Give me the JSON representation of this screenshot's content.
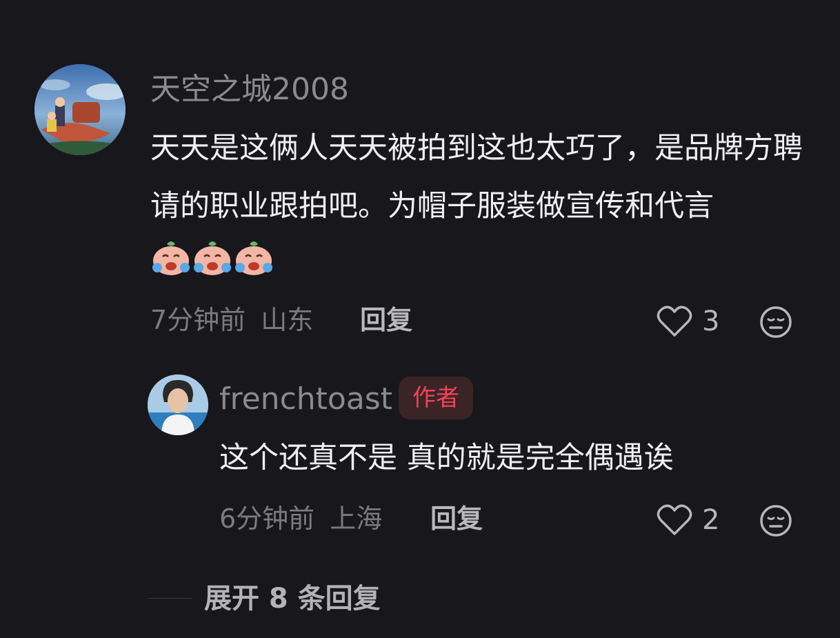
{
  "comments": [
    {
      "username": "天空之城2008",
      "text": "天天是这俩人天天被拍到这也太巧了，是品牌方聘请的职业跟拍吧。为帽子服装做宣传和代言",
      "emojis": [
        "crying-face-emoji",
        "crying-face-emoji",
        "crying-face-emoji"
      ],
      "time": "7分钟前",
      "location": "山东",
      "reply_label": "回复",
      "likes": "3",
      "like_icon": "heart-outline-icon",
      "dislike_icon": "meh-face-icon"
    }
  ],
  "replies": [
    {
      "username": "frenchtoast",
      "badge": "作者",
      "text": "这个还真不是 真的就是完全偶遇诶",
      "time": "6分钟前",
      "location": "上海",
      "reply_label": "回复",
      "likes": "2",
      "like_icon": "heart-outline-icon",
      "dislike_icon": "meh-face-icon"
    }
  ],
  "expand_replies": "展开 8 条回复",
  "colors": {
    "background": "#17171c",
    "author_badge_bg": "#3a2426",
    "author_badge_text": "#f0435a"
  }
}
